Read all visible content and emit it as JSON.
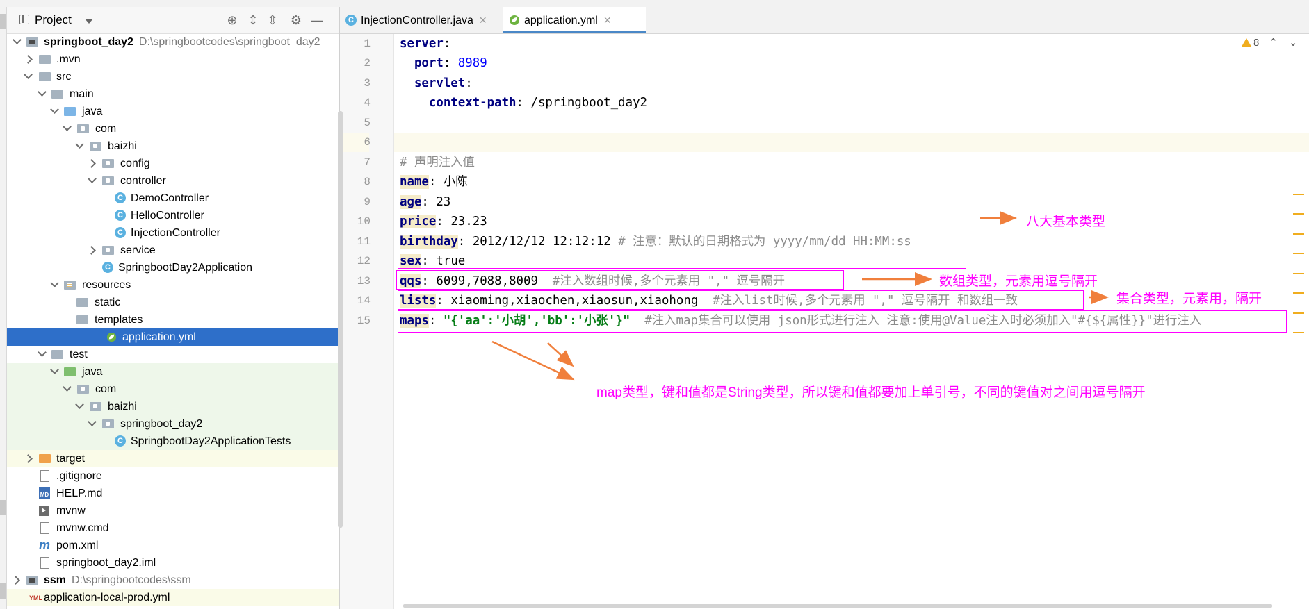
{
  "project_panel": {
    "title": "Project",
    "items": [
      {
        "label": "springboot_day2",
        "path": "D:\\springbootcodes\\springboot_day2",
        "bold": true
      },
      {
        "label": ".mvn"
      },
      {
        "label": "src"
      },
      {
        "label": "main"
      },
      {
        "label": "java"
      },
      {
        "label": "com"
      },
      {
        "label": "baizhi"
      },
      {
        "label": "config"
      },
      {
        "label": "controller"
      },
      {
        "label": "DemoController"
      },
      {
        "label": "HelloController"
      },
      {
        "label": "InjectionController"
      },
      {
        "label": "service"
      },
      {
        "label": "SpringbootDay2Application"
      },
      {
        "label": "resources"
      },
      {
        "label": "static"
      },
      {
        "label": "templates"
      },
      {
        "label": "application.yml"
      },
      {
        "label": "test"
      },
      {
        "label": "java"
      },
      {
        "label": "com"
      },
      {
        "label": "baizhi"
      },
      {
        "label": "springboot_day2"
      },
      {
        "label": "SpringbootDay2ApplicationTests"
      },
      {
        "label": "target"
      },
      {
        "label": ".gitignore"
      },
      {
        "label": "HELP.md"
      },
      {
        "label": "mvnw"
      },
      {
        "label": "mvnw.cmd"
      },
      {
        "label": "pom.xml"
      },
      {
        "label": "springboot_day2.iml"
      },
      {
        "label": "ssm",
        "path": "D:\\springbootcodes\\ssm",
        "bold": true
      },
      {
        "label": "application-local-prod.yml"
      }
    ]
  },
  "tabs": [
    {
      "label": "InjectionController.java"
    },
    {
      "label": "application.yml"
    }
  ],
  "editor": {
    "warning_count": "8",
    "line_numbers": [
      "1",
      "2",
      "3",
      "4",
      "5",
      "6",
      "7",
      "8",
      "9",
      "10",
      "11",
      "12",
      "13",
      "14",
      "15"
    ],
    "lines": {
      "l1_key": "server",
      "l2_key": "port",
      "l2_val": "8989",
      "l3_key": "servlet",
      "l4_key": "context-path",
      "l4_val": "/springboot_day2",
      "l7_comment": "# 声明注入值",
      "l8_key": "name",
      "l8_val": "小陈",
      "l9_key": "age",
      "l9_val": "23",
      "l10_key": "price",
      "l10_val": "23.23",
      "l11_key": "birthday",
      "l11_val": "2012/12/12 12:12:12",
      "l11_comment": "# 注意：默认的日期格式为 yyyy/mm/dd HH:MM:ss",
      "l12_key": "sex",
      "l12_val": "true",
      "l13_key": "qqs",
      "l13_val": "6099,7088,8009",
      "l13_comment": "#注入数组时候,多个元素用 \",\" 逗号隔开",
      "l14_key": "lists",
      "l14_val": "xiaoming,xiaochen,xiaosun,xiaohong",
      "l14_comment": "#注入list时候,多个元素用 \",\" 逗号隔开 和数组一致",
      "l15_key": "maps",
      "l15_val": "\"{'aa':'小胡','bb':'小张'}\"",
      "l15_comment": "#注入map集合可以使用 json形式进行注入 注意:使用@Value注入时必须加入\"#{${属性}}\"进行注入"
    }
  },
  "annotations": {
    "basic_types": "八大基本类型",
    "array_type": "数组类型，元素用逗号隔开",
    "collection_type": "集合类型，元素用，隔开",
    "map_type": "map类型，键和值都是String类型，所以键和值都要加上单引号，不同的键值对之间用逗号隔开",
    "color": "#ff00ff",
    "arrow_color": "#f07f3c"
  }
}
